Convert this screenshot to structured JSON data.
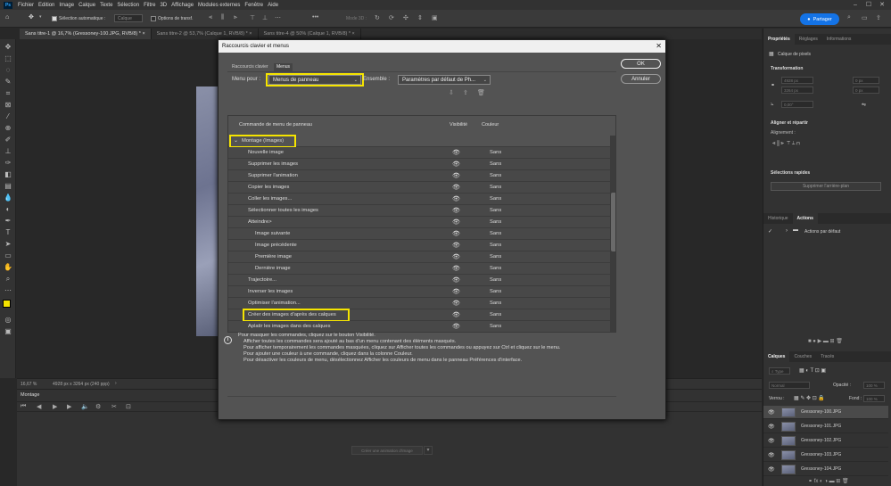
{
  "app": {
    "logo": "Ps"
  },
  "menubar": [
    "Fichier",
    "Edition",
    "Image",
    "Calque",
    "Texte",
    "Sélection",
    "Filtre",
    "3D",
    "Affichage",
    "Modules externes",
    "Fenêtre",
    "Aide"
  ],
  "options": {
    "auto_select_label": "Sélection automatique :",
    "auto_select_value": "Calque",
    "transform_label": "Options de transf.",
    "mode3d": "Mode 3D :",
    "share_label": "Partager"
  },
  "doc_tabs": [
    {
      "label": "Sans titre-1 @ 16,7% (Gressoney-100.JPG, RVB/8) *",
      "active": true
    },
    {
      "label": "Sans titre-2 @ 53,7% (Calque 1, RVB/8) *",
      "active": false
    },
    {
      "label": "Sans titre-4 @ 50% (Calque 1, RVB/8) *",
      "active": false
    }
  ],
  "status": {
    "zoom": "16,67 %",
    "docsize": "4928 px x 3264 px (240 ppp)"
  },
  "timeline": {
    "tab": "Montage",
    "create_button": "Créer une animation d'image"
  },
  "properties_panel": {
    "tabs": [
      "Propriétés",
      "Réglages",
      "Informations"
    ],
    "layer_type": "Calque de pixels",
    "transform": "Transformation",
    "w": "4928 px",
    "h": "3264 px",
    "x": "0 px",
    "y": "0 px",
    "angle": "0,00°",
    "align_title": "Aligner et répartir",
    "align_sub": "Alignement :",
    "quick_title": "Sélections rapides",
    "quick_btn": "Supprimer l'arrière-plan"
  },
  "history_panel": {
    "tabs": [
      "Historique",
      "Actions"
    ],
    "item": "Actions par défaut"
  },
  "layers_panel": {
    "tabs": [
      "Calques",
      "Couches",
      "Tracés"
    ],
    "filter": "Type",
    "blend": "Normal",
    "opacity_label": "Opacité :",
    "opacity": "100 %",
    "lock_label": "Verrou :",
    "fill_label": "Fond :",
    "fill": "100 %",
    "layers": [
      "Gressoney-100.JPG",
      "Gressoney-101.JPG",
      "Gressoney-102.JPG",
      "Gressoney-103.JPG",
      "Gressoney-104.JPG"
    ]
  },
  "dialog": {
    "title": "Raccourcis clavier et menus",
    "tabs": [
      "Raccourcis clavier",
      "Menus"
    ],
    "ok": "OK",
    "cancel": "Annuler",
    "menu_for_label": "Menu pour :",
    "menu_for_value": "Menus de panneau",
    "set_label": "Ensemble :",
    "set_value": "Paramètres par défaut de Ph...",
    "col_command": "Commande de menu de panneau",
    "col_visibility": "Visibilité",
    "col_color": "Couleur",
    "group": "Montage (Images)",
    "rows": [
      {
        "name": "Nouvelle image",
        "indent": 1,
        "color": "Sans"
      },
      {
        "name": "Supprimer les images",
        "indent": 1,
        "color": "Sans"
      },
      {
        "name": "Supprimer l'animation",
        "indent": 1,
        "color": "Sans"
      },
      {
        "name": "Copier les images",
        "indent": 1,
        "color": "Sans"
      },
      {
        "name": "Coller les images...",
        "indent": 1,
        "color": "Sans"
      },
      {
        "name": "Sélectionner toutes les images",
        "indent": 1,
        "color": "Sans"
      },
      {
        "name": "Atteindre>",
        "indent": 1,
        "color": "Sans"
      },
      {
        "name": "Image suivante",
        "indent": 2,
        "color": "Sans"
      },
      {
        "name": "Image précédente",
        "indent": 2,
        "color": "Sans"
      },
      {
        "name": "Première image",
        "indent": 2,
        "color": "Sans"
      },
      {
        "name": "Dernière image",
        "indent": 2,
        "color": "Sans"
      },
      {
        "name": "Trajectoire...",
        "indent": 1,
        "color": "Sans"
      },
      {
        "name": "Inverser les images",
        "indent": 1,
        "color": "Sans"
      },
      {
        "name": "Optimiser l'animation...",
        "indent": 1,
        "color": "Sans"
      },
      {
        "name": "Créer des images d'après des calques",
        "indent": 1,
        "color": "Sans"
      },
      {
        "name": "Aplatir les images dans des calques",
        "indent": 1,
        "color": "Sans"
      }
    ],
    "info": [
      "Pour masquer les commandes, cliquez sur le bouton Visibilité.",
      "Afficher toutes les commandes sera ajouté au bas d'un menu contenant des éléments masqués.",
      "Pour afficher temporairement les commandes masquées, cliquez sur Afficher toutes les commandes ou appuyez sur Ctrl et cliquez sur le menu.",
      "Pour ajouter une couleur à une commande, cliquez dans la colonne Couleur.",
      "Pour désactiver les couleurs de menu, désélectionnez Afficher les couleurs de menu dans le panneau Préférences d'interface."
    ]
  },
  "colors": {
    "highlight": "#f5e400",
    "accent": "#1473e6"
  }
}
